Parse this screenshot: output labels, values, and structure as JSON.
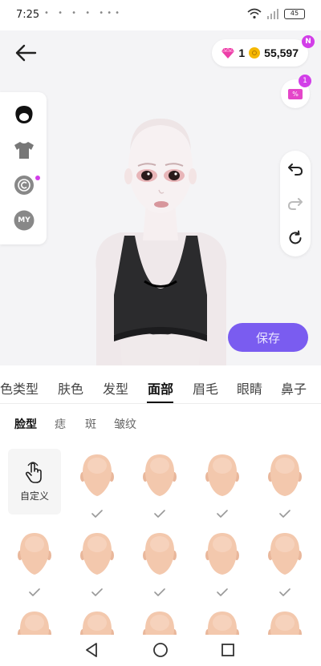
{
  "status_bar": {
    "time": "7:25",
    "notification_dots": "• • • • •••",
    "battery": "45"
  },
  "header": {
    "back_icon": "arrow-left-icon",
    "gems": "1",
    "coins": "55,597",
    "new_badge": "N",
    "promo_tag": "%",
    "promo_badge": "1"
  },
  "left_menu": {
    "items": [
      "hair-icon",
      "shirt-icon",
      "copyright-icon",
      "my-icon"
    ],
    "my_label": "MY"
  },
  "right_tools": {
    "items": [
      "undo-icon",
      "redo-icon",
      "reset-icon"
    ]
  },
  "save_label": "保存",
  "categories": [
    "色类型",
    "肤色",
    "发型",
    "面部",
    "眉毛",
    "眼睛",
    "鼻子"
  ],
  "active_category": "面部",
  "sub_tabs": [
    "脸型",
    "痣",
    "斑",
    "皱纹"
  ],
  "active_sub_tab": "脸型",
  "custom_label": "自定义",
  "colors": {
    "accent": "#7a5cf0",
    "badge": "#d23ee8",
    "coin": "#f5b700",
    "skin": "#f3c8ad"
  }
}
